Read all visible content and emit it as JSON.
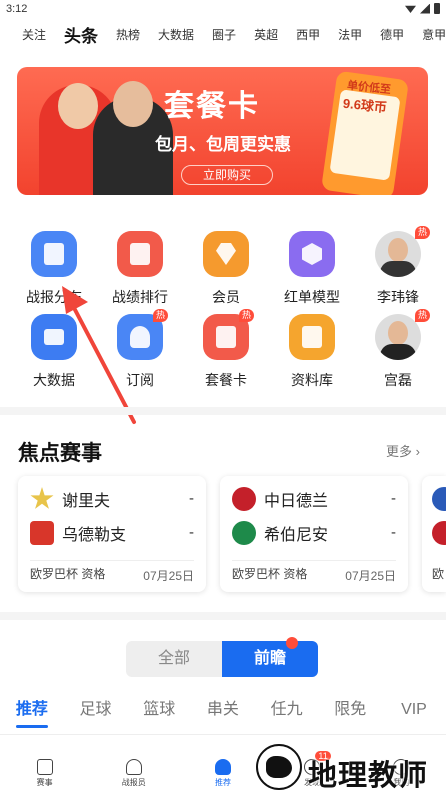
{
  "status": {
    "time": "3:12"
  },
  "top_tabs": [
    {
      "label": "关注",
      "active": false
    },
    {
      "label": "头条",
      "active": true
    },
    {
      "label": "热榜",
      "active": false
    },
    {
      "label": "大数据",
      "active": false
    },
    {
      "label": "圈子",
      "active": false
    },
    {
      "label": "英超",
      "active": false
    },
    {
      "label": "西甲",
      "active": false
    },
    {
      "label": "法甲",
      "active": false
    },
    {
      "label": "德甲",
      "active": false
    },
    {
      "label": "意甲",
      "active": false
    }
  ],
  "banner": {
    "title": "套餐卡",
    "subtitle": "包月、包周更实惠",
    "button": "立即购买",
    "price_line1": "单价低至",
    "price_line2": "9.6球币"
  },
  "grid": [
    {
      "label": "战报分布",
      "icon": "report-icon",
      "color": "#4a86f5",
      "hot": false
    },
    {
      "label": "战绩排行",
      "icon": "ranking-icon",
      "color": "#f25a4a",
      "hot": false
    },
    {
      "label": "会员",
      "icon": "diamond-icon",
      "color": "#f59a2e",
      "hot": false
    },
    {
      "label": "红单模型",
      "icon": "ai-model-icon",
      "color": "#8a6cf0",
      "hot": false
    },
    {
      "label": "李玮锋",
      "icon": "avatar",
      "color": "#dddddd",
      "hot": true,
      "hot_label": "热"
    },
    {
      "label": "大数据",
      "icon": "chart-icon",
      "color": "#3d7cf2",
      "hot": false
    },
    {
      "label": "订阅",
      "icon": "subscribe-icon",
      "color": "#4a86f5",
      "hot": true,
      "hot_label": "热"
    },
    {
      "label": "套餐卡",
      "icon": "package-card-icon",
      "color": "#f25a4a",
      "hot": true,
      "hot_label": "热"
    },
    {
      "label": "资料库",
      "icon": "database-icon",
      "color": "#f5a52e",
      "hot": false
    },
    {
      "label": "宫磊",
      "icon": "avatar",
      "color": "#dddddd",
      "hot": true,
      "hot_label": "热"
    }
  ],
  "focus": {
    "title": "焦点赛事",
    "more": "更多 ›",
    "matches": [
      {
        "home": "谢里夫",
        "home_score": "-",
        "home_color": "#e8c44a",
        "away": "乌德勒支",
        "away_score": "-",
        "away_color": "#d8362a",
        "league": "欧罗巴杯 资格",
        "date": "07月25日"
      },
      {
        "home": "中日德兰",
        "home_score": "-",
        "home_color": "#c4202a",
        "away": "希伯尼安",
        "away_score": "-",
        "away_color": "#1e8a4a",
        "league": "欧罗巴杯 资格",
        "date": "07月25日"
      },
      {
        "home": "",
        "home_score": "",
        "home_color": "#2a5ab8",
        "away": "",
        "away_score": "",
        "away_color": "#c4202a",
        "league": "欧",
        "date": ""
      }
    ]
  },
  "toggle": {
    "all": "全部",
    "preview": "前瞻"
  },
  "sub_tabs": [
    "推荐",
    "足球",
    "篮球",
    "串关",
    "任九",
    "限免",
    "VIP"
  ],
  "bottom_nav": [
    {
      "label": "赛事",
      "active": false
    },
    {
      "label": "战报员",
      "active": false
    },
    {
      "label": "推荐",
      "active": true
    },
    {
      "label": "发现",
      "active": false,
      "badge": "11"
    },
    {
      "label": "我的",
      "active": false
    }
  ],
  "watermark": {
    "text": "地理教师"
  }
}
